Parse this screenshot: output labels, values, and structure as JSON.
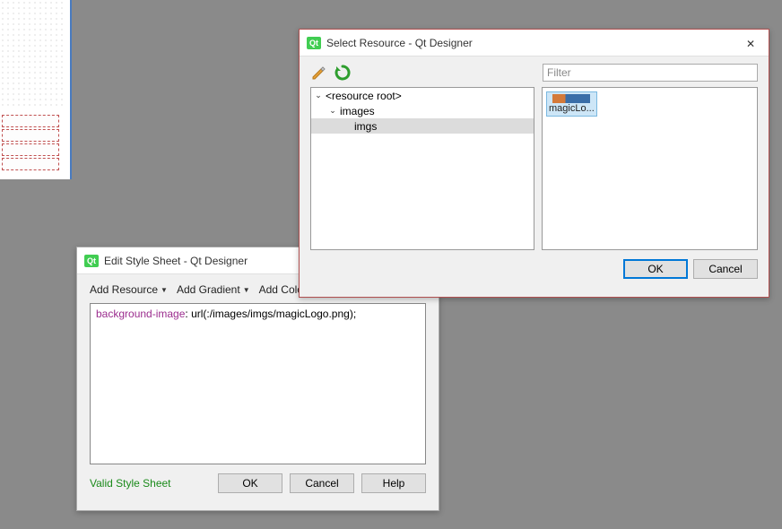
{
  "canvas": {
    "rows": [
      128,
      144,
      160,
      176
    ]
  },
  "resource_dialog": {
    "title": "Select Resource - Qt Designer",
    "filter_placeholder": "Filter",
    "tree": [
      {
        "level": 0,
        "expanded": true,
        "label": "<resource root>"
      },
      {
        "level": 1,
        "expanded": true,
        "label": "images"
      },
      {
        "level": 2,
        "expanded": null,
        "label": "imgs",
        "selected": true
      }
    ],
    "items": [
      {
        "name": "magicLo...",
        "selected": true
      }
    ],
    "ok_label": "OK",
    "cancel_label": "Cancel"
  },
  "stylesheet_dialog": {
    "title": "Edit Style Sheet - Qt Designer",
    "tools": {
      "add_resource": "Add Resource",
      "add_gradient": "Add Gradient",
      "add_color": "Add Colo"
    },
    "editor": {
      "property": "background-image",
      "rest": ": url(:/images/imgs/magicLogo.png);"
    },
    "status": "Valid Style Sheet",
    "ok_label": "OK",
    "cancel_label": "Cancel",
    "help_label": "Help"
  }
}
